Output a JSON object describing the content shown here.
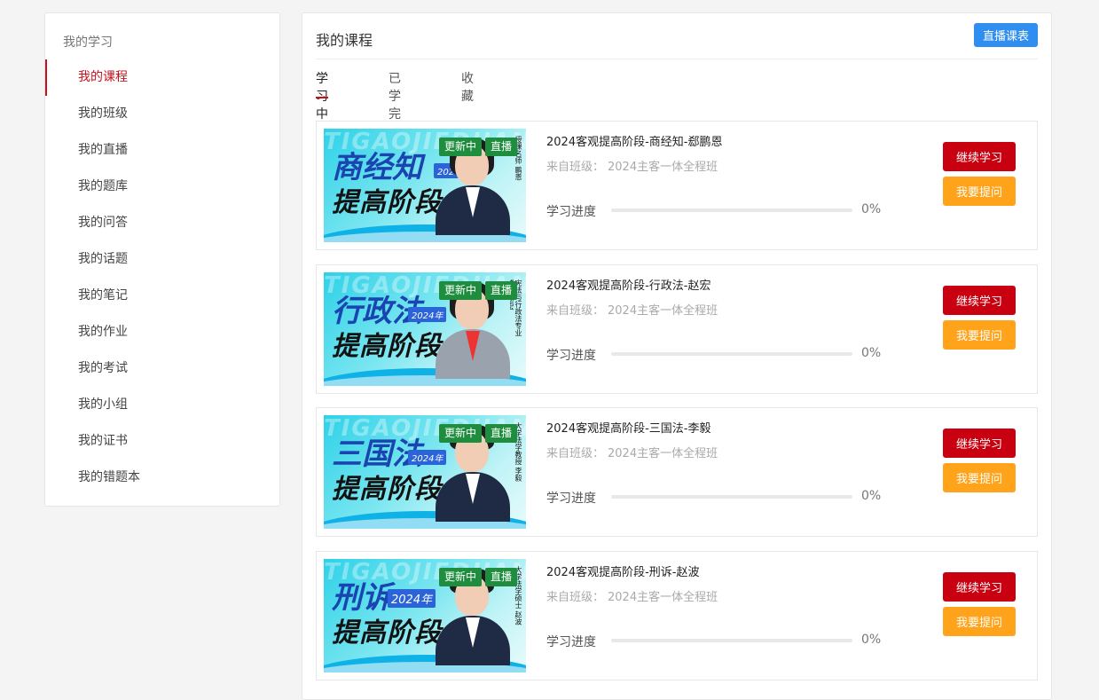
{
  "sidebar": {
    "title": "我的学习",
    "items": [
      {
        "label": "我的课程",
        "active": true
      },
      {
        "label": "我的班级"
      },
      {
        "label": "我的直播"
      },
      {
        "label": "我的题库"
      },
      {
        "label": "我的问答"
      },
      {
        "label": "我的话题"
      },
      {
        "label": "我的笔记"
      },
      {
        "label": "我的作业"
      },
      {
        "label": "我的考试"
      },
      {
        "label": "我的小组"
      },
      {
        "label": "我的证书"
      },
      {
        "label": "我的错题本"
      }
    ]
  },
  "main": {
    "title": "我的课程",
    "live_schedule_label": "直播课表",
    "tabs": [
      {
        "label": "学习中",
        "active": true
      },
      {
        "label": "已学完"
      },
      {
        "label": "收藏"
      }
    ]
  },
  "labels": {
    "from_class": "来自班级：",
    "progress": "学习进度",
    "continue": "继续学习",
    "ask": "我要提问",
    "badge_updating": "更新中",
    "badge_live": "直播"
  },
  "courses": [
    {
      "title": "2024客观提高阶段-商经知-郄鹏恩",
      "class_name": "2024主客一体全程班",
      "progress_pct": "0%",
      "progress": 0,
      "cover": {
        "subject": "商经知",
        "year": "2024年",
        "stage": "提高阶段",
        "watermark": "TIGAOJIEDUAN",
        "teacher": "授课名师 鹏恩"
      }
    },
    {
      "title": "2024客观提高阶段-行政法-赵宏",
      "class_name": "2024主客一体全程班",
      "progress_pct": "0%",
      "progress": 0,
      "cover": {
        "subject": "行政法",
        "year": "2024年",
        "stage": "提高阶段",
        "watermark": "TIGAOJIEDUAN",
        "teacher": "宪法与行政法专业博士 赵宏"
      }
    },
    {
      "title": "2024客观提高阶段-三国法-李毅",
      "class_name": "2024主客一体全程班",
      "progress_pct": "0%",
      "progress": 0,
      "cover": {
        "subject": "三国法",
        "year": "2024年",
        "stage": "提高阶段",
        "watermark": "TIGAOJIEDUAN",
        "teacher": "大学法学教授 李毅"
      }
    },
    {
      "title": "2024客观提高阶段-刑诉-赵波",
      "class_name": "2024主客一体全程班",
      "progress_pct": "0%",
      "progress": 0,
      "cover": {
        "subject": "刑诉",
        "year": "2024年",
        "stage": "提高阶段",
        "watermark": "TIGAOJIEDUAN",
        "teacher": "大学法学硕士 赵波"
      }
    }
  ]
}
